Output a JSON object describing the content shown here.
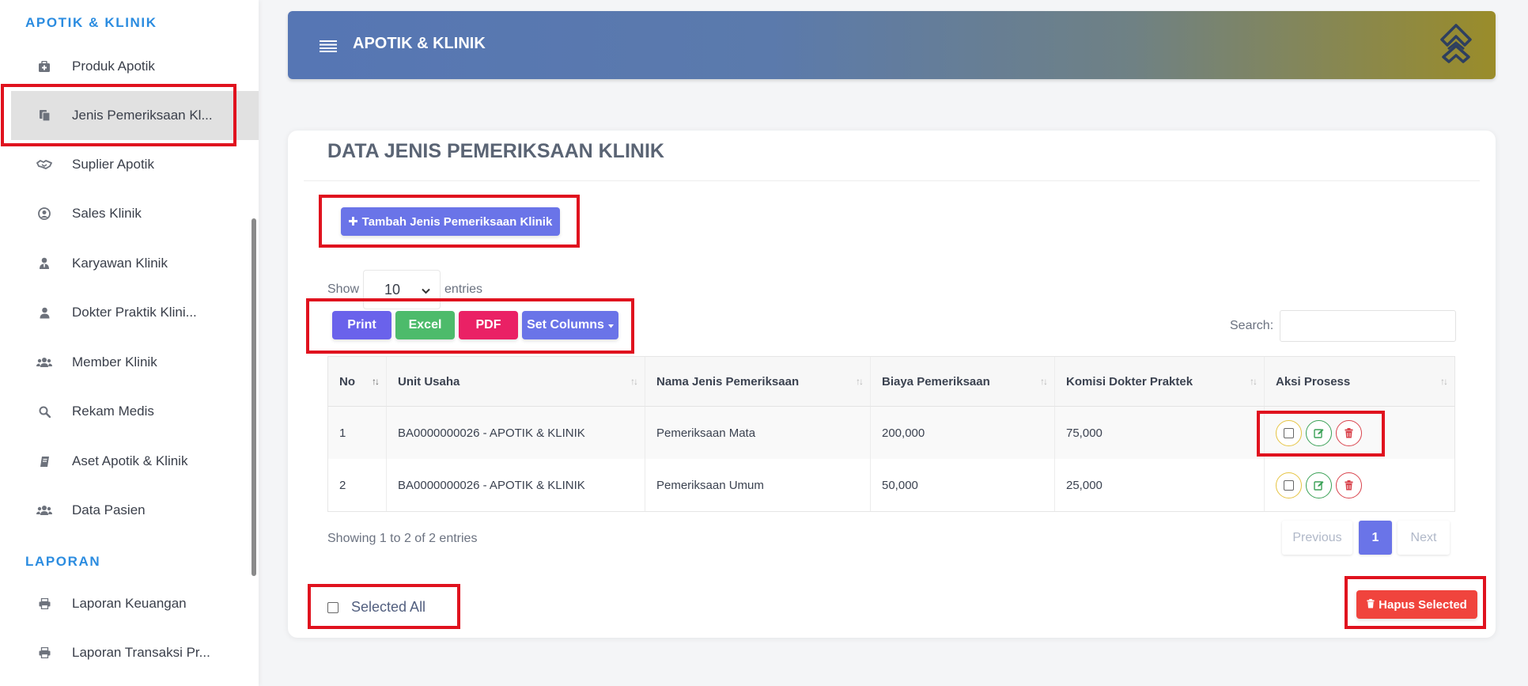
{
  "sidebar": {
    "section_apotik": "APOTIK & KLINIK",
    "section_laporan": "LAPORAN",
    "items": [
      {
        "label": "Produk Apotik",
        "icon": "medkit-icon"
      },
      {
        "label": "Jenis Pemeriksaan Kl...",
        "icon": "copy-icon"
      },
      {
        "label": "Suplier Apotik",
        "icon": "handshake-icon"
      },
      {
        "label": "Sales Klinik",
        "icon": "user-circle-icon"
      },
      {
        "label": "Karyawan Klinik",
        "icon": "user-tie-icon"
      },
      {
        "label": "Dokter Praktik Klini...",
        "icon": "user-icon"
      },
      {
        "label": "Member Klinik",
        "icon": "users-icon"
      },
      {
        "label": "Rekam Medis",
        "icon": "search-icon"
      },
      {
        "label": "Aset Apotik & Klinik",
        "icon": "book-icon"
      },
      {
        "label": "Data Pasien",
        "icon": "users-icon"
      }
    ],
    "laporan_items": [
      {
        "label": "Laporan Keuangan",
        "icon": "printer-icon"
      },
      {
        "label": "Laporan Transaksi Pr...",
        "icon": "printer-icon"
      }
    ],
    "active_index": 1
  },
  "header": {
    "title": "APOTIK & KLINIK"
  },
  "card": {
    "title": "DATA JENIS PEMERIKSAAN KLINIK",
    "add_button": "Tambah Jenis Pemeriksaan Klinik",
    "show_label": "Show",
    "entries_value": "10",
    "entries_label": "entries",
    "export_buttons": {
      "print": "Print",
      "excel": "Excel",
      "pdf": "PDF",
      "columns": "Set Columns"
    },
    "search_label": "Search:",
    "search_value": ""
  },
  "table": {
    "columns": [
      "No",
      "Unit Usaha",
      "Nama Jenis Pemeriksaan",
      "Biaya Pemeriksaan",
      "Komisi Dokter Praktek",
      "Aksi Prosess"
    ],
    "rows": [
      [
        "1",
        "BA0000000026 - APOTIK & KLINIK",
        "Pemeriksaan Mata",
        "200,000",
        "75,000"
      ],
      [
        "2",
        "BA0000000026 - APOTIK & KLINIK",
        "Pemeriksaan Umum",
        "50,000",
        "25,000"
      ]
    ]
  },
  "footer": {
    "info": "Showing 1 to 2 of 2 entries",
    "previous": "Previous",
    "page": "1",
    "next": "Next",
    "select_all": "Selected All",
    "delete_selected": "Hapus Selected"
  },
  "colors": {
    "accent": "#6a74e8",
    "highlight": "#e0121e"
  }
}
